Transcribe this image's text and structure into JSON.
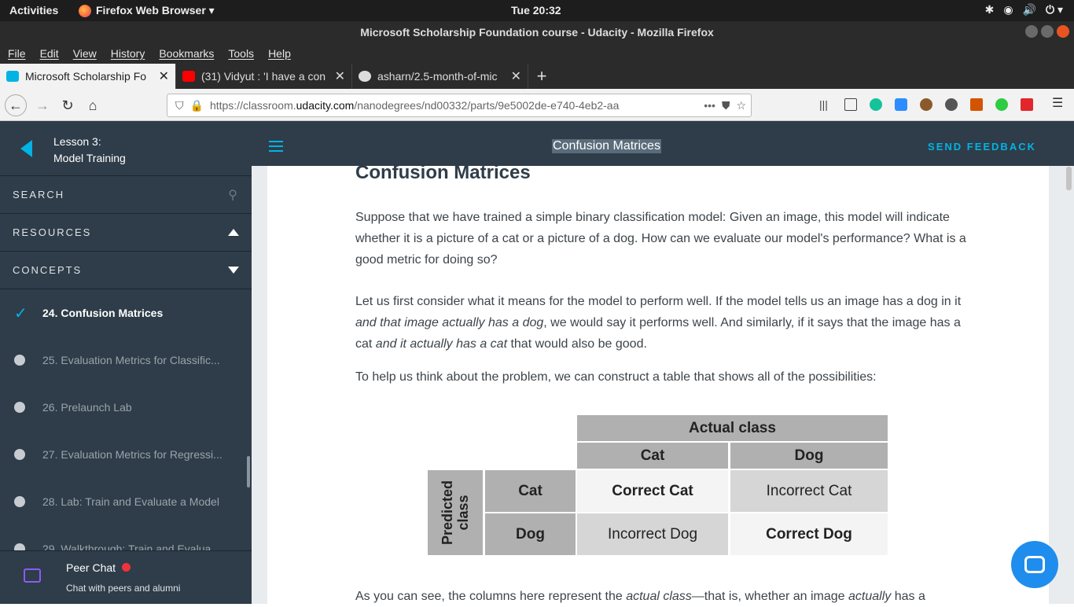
{
  "topbar": {
    "activities": "Activities",
    "app": "Firefox Web Browser ▾",
    "clock": "Tue 20:32",
    "tray": [
      "✱",
      "◉",
      "🔊",
      "⏻ ▾"
    ]
  },
  "window": {
    "title": "Microsoft Scholarship Foundation course - Udacity - Mozilla Firefox"
  },
  "menu": [
    "File",
    "Edit",
    "View",
    "History",
    "Bookmarks",
    "Tools",
    "Help"
  ],
  "tabs": [
    {
      "label": "Microsoft Scholarship Fo",
      "color": "#02b3e4"
    },
    {
      "label": "(31) Vidyut : 'I have a con",
      "color": "#ff0000"
    },
    {
      "label": "asharn/2.5-month-of-mic",
      "color": "#dddddd"
    }
  ],
  "nav": {
    "url_prefix": "https://classroom.",
    "url_domain": "udacity.com",
    "url_rest": "/nanodegrees/nd00332/parts/9e5002de-e740-4eb2-aa",
    "more": "•••"
  },
  "sidebar": {
    "lesson_line1": "Lesson 3:",
    "lesson_line2": "Model Training",
    "search": "SEARCH",
    "resources": "RESOURCES",
    "concepts": "CONCEPTS",
    "items": [
      {
        "label": "24. Confusion Matrices",
        "active": true
      },
      {
        "label": "25. Evaluation Metrics for Classific..."
      },
      {
        "label": "26. Prelaunch Lab"
      },
      {
        "label": "27. Evaluation Metrics for Regressi..."
      },
      {
        "label": "28. Lab: Train and Evaluate a Model"
      },
      {
        "label": "29. Walkthrough: Train and Evalua..."
      }
    ],
    "peer_title": "Peer Chat",
    "peer_sub": "Chat with peers and alumni"
  },
  "header": {
    "title": "Confusion Matrices",
    "feedback": "SEND FEEDBACK"
  },
  "content": {
    "heading": "Confusion Matrices",
    "p1": "Suppose that we have trained a simple binary classification model: Given an image, this model will indicate whether it is a picture of a cat or a picture of a dog. How can we evaluate our model's performance? What is a good metric for doing so?",
    "p2a": "Let us first consider what it means for the model to perform well. If the model tells us an image has a dog in it ",
    "p2b": "and that image actually has a dog",
    "p2c": ", we would say it performs well. And similarly, if it says that the image has a cat ",
    "p2d": "and it actually has a cat",
    "p2e": " that would also be good.",
    "p3": "To help us think about the problem, we can construct a table that shows all of the possibilities:",
    "p4a": "As you can see, the columns here represent the ",
    "p4b": "actual class",
    "p4c": "—that is, whether an image ",
    "p4d": "actually",
    "p4e": " has a"
  },
  "table": {
    "actual": "Actual class",
    "predicted": "Predicted class",
    "col_cat": "Cat",
    "col_dog": "Dog",
    "row_cat": "Cat",
    "row_dog": "Dog",
    "cc": "Correct Cat",
    "ic": "Incorrect Cat",
    "id": "Incorrect Dog",
    "cd": "Correct Dog"
  }
}
